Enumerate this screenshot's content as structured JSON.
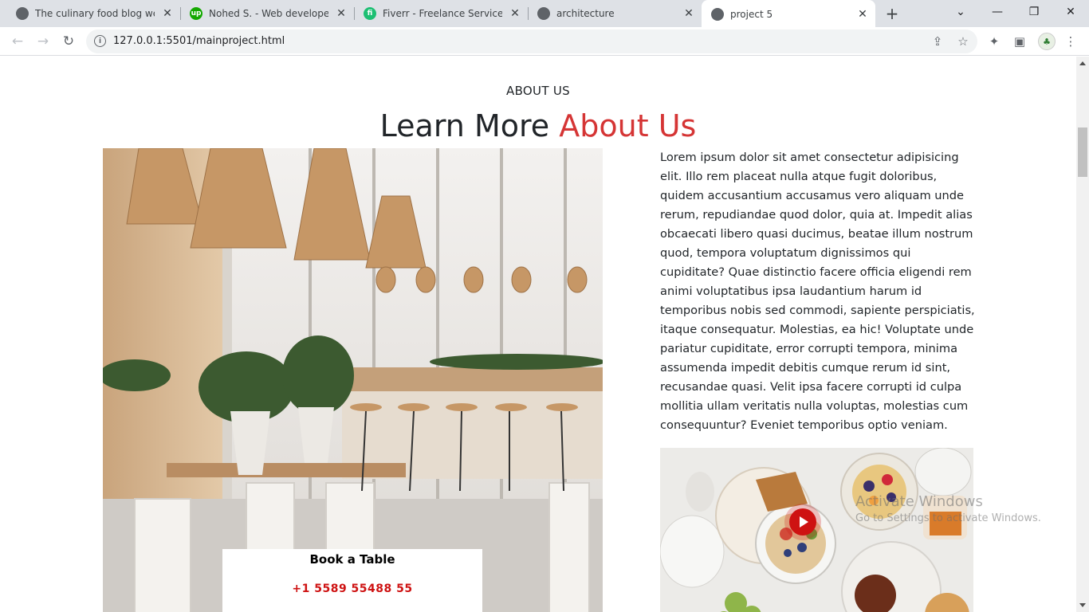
{
  "browser": {
    "tabs": [
      {
        "title": "The culinary food blog websi",
        "active": false
      },
      {
        "title": "Nohed S. - Web developer - ",
        "active": false
      },
      {
        "title": "Fiverr - Freelance Services Ma",
        "active": false
      },
      {
        "title": "architecture",
        "active": false
      },
      {
        "title": "project 5",
        "active": true
      }
    ],
    "new_tab_symbol": "+",
    "url": "127.0.0.1:5501/mainproject.html",
    "favicon_upwork": "up",
    "favicon_fiverr": "fi"
  },
  "about": {
    "label": "ABOUT US",
    "heading_main": "Learn More",
    "heading_accent": "About Us",
    "paragraph": "Lorem ipsum dolor sit amet consectetur adipisicing elit. Illo rem placeat nulla atque fugit doloribus, quidem accusantium accusamus vero aliquam unde rerum, repudiandae quod dolor, quia at. Impedit alias obcaecati libero quasi ducimus, beatae illum nostrum quod, tempora voluptatum dignissimos qui cupiditate? Quae distinctio facere officia eligendi rem animi voluptatibus ipsa laudantium harum id temporibus nobis sed commodi, sapiente perspiciatis, itaque consequatur. Molestias, ea hic! Voluptate unde pariatur cupiditate, error corrupti tempora, minima assumenda impedit debitis cumque rerum id sint, recusandae quasi. Velit ipsa facere corrupti id culpa mollitia ullam veritatis nulla voluptas, molestias cum consequuntur? Eveniet temporibus optio veniam.",
    "book_title": "Book a Table",
    "book_phone": "+1 5589 55488 55"
  },
  "watermark": {
    "line1": "Activate Windows",
    "line2": "Go to Settings to activate Windows."
  },
  "colors": {
    "accent": "#ce1212",
    "tabstrip": "#dee1e6"
  }
}
